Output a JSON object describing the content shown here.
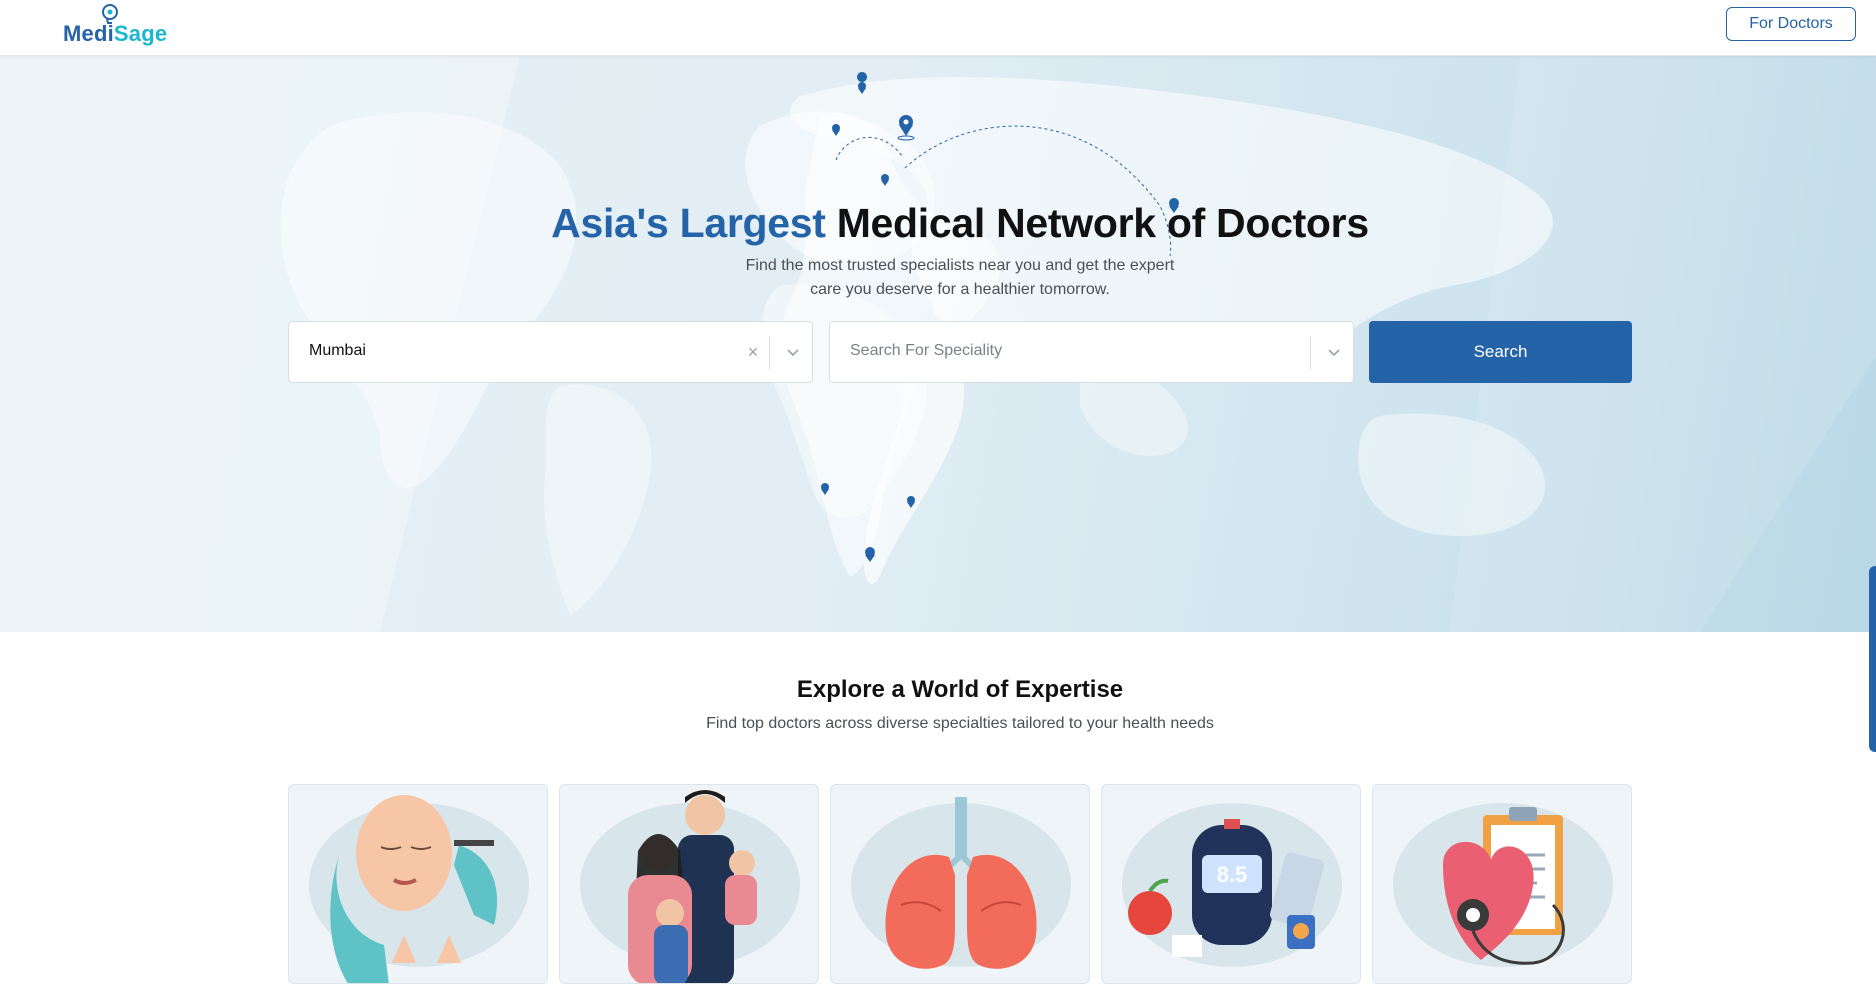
{
  "header": {
    "logo_part1": "Medi",
    "logo_part2": "Sage",
    "for_doctors_label": "For Doctors"
  },
  "hero": {
    "title_accent": "Asia's Largest",
    "title_main": "Medical Network of Doctors",
    "subtitle_line1": "Find the most trusted specialists near you and get the expert",
    "subtitle_line2": "care you deserve for a healthier tomorrow."
  },
  "search": {
    "location_value": "Mumbai",
    "clear_glyph": "×",
    "speciality_placeholder": "Search For Speciality",
    "button_label": "Search"
  },
  "expertise": {
    "title": "Explore a World of Expertise",
    "subtitle": "Find top doctors across diverse specialties tailored to your health needs",
    "cards": [
      {
        "icon": "dermatology-face-icon"
      },
      {
        "icon": "family-medicine-icon"
      },
      {
        "icon": "lungs-icon"
      },
      {
        "icon": "diabetes-glucometer-icon",
        "reading": "8.5"
      },
      {
        "icon": "cardiology-heart-icon"
      }
    ]
  },
  "colors": {
    "brand": "#2563a8",
    "brand_light": "#1bb6cf",
    "hero_bg": "#e2eef4"
  }
}
